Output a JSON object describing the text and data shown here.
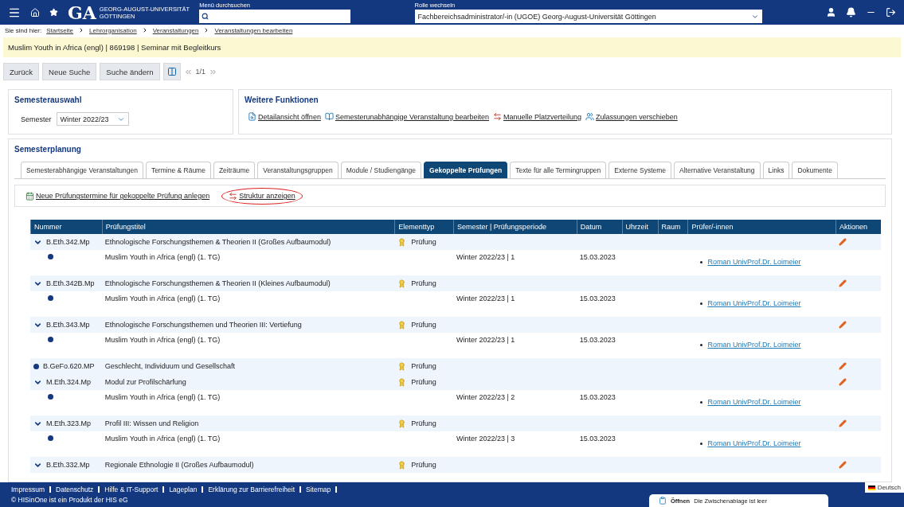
{
  "header": {
    "logo_mark": "GA",
    "logo_line_1": "GEORG-AUGUST-UNIVERSITÄT",
    "logo_line_2": "GÖTTINGEN",
    "search_label": "Menü durchsuchen",
    "role_label": "Rolle wechseln",
    "role_value": "Fachbereichsadministrator/-in (UGOE) Georg-August-Universität Göttingen"
  },
  "breadcrumb": {
    "label": "Sie sind hier:",
    "items": [
      "Startseite",
      "Lehrorganisation",
      "Veranstaltungen",
      "Veranstaltungen bearbeiten"
    ]
  },
  "title_bar": "Muslim Youth in Africa (engl) | 869198 | Seminar mit Begleitkurs",
  "toolbar": {
    "buttons": [
      "Zurück",
      "Neue Suche",
      "Suche ändern"
    ],
    "pager": "1/1"
  },
  "semester_panel": {
    "title": "Semesterauswahl",
    "label": "Semester",
    "value": "Winter 2022/23"
  },
  "functions_panel": {
    "title": "Weitere Funktionen",
    "links": [
      {
        "kind": "detail",
        "label": "Detailansicht öffnen"
      },
      {
        "kind": "book",
        "label": "Semesterunabhängige Veranstaltung bearbeiten"
      },
      {
        "kind": "swap",
        "label": "Manuelle Platzverteilung"
      },
      {
        "kind": "people",
        "label": "Zulassungen verschieben"
      }
    ]
  },
  "planning": {
    "title": "Semesterplanung",
    "tabs": [
      {
        "label": "Semesterabhängige Veranstaltungen",
        "selected": false
      },
      {
        "label": "Termine & Räume",
        "selected": false
      },
      {
        "label": "Zeiträume",
        "selected": false
      },
      {
        "label": "Veranstaltungsgruppen",
        "selected": false
      },
      {
        "label": "Module / Studiengänge",
        "selected": false
      },
      {
        "label": "Gekoppelte Prüfungen",
        "selected": true
      },
      {
        "label": "Texte für alle Termingruppen",
        "selected": false
      },
      {
        "label": "Externe Systeme",
        "selected": false
      },
      {
        "label": "Alternative Veranstaltung",
        "selected": false
      },
      {
        "label": "Links",
        "selected": false
      },
      {
        "label": "Dokumente",
        "selected": false
      }
    ],
    "actions": [
      {
        "kind": "calendar",
        "label": "Neue Prüfungstermine für gekoppelte Prüfung anlegen",
        "circled": false
      },
      {
        "kind": "swap",
        "label": "Struktur anzeigen",
        "circled": true
      }
    ]
  },
  "table": {
    "columns": [
      "Nummer",
      "Prüfungstitel",
      "Elementtyp",
      "Semester | Prüfungsperiode",
      "Datum",
      "Uhrzeit",
      "Raum",
      "Prüfer/-innen",
      "Aktionen"
    ],
    "rows": [
      {
        "kind": "branch",
        "expanded": true,
        "number": "B.Eth.342.Mp",
        "title": "Ethnologische Forschungsthemen & Theorien II (Großes Aufbaumodul)",
        "type": "Prüfung",
        "children": [
          {
            "title": "Muslim Youth in Africa (engl) (1. TG)",
            "semester": "Winter 2022/23 | 1",
            "date": "15.03.2023",
            "examiner": "Roman UnivProf.Dr. Loimeier"
          }
        ]
      },
      {
        "kind": "branch",
        "expanded": true,
        "number": "B.Eth.342B.Mp",
        "title": "Ethnologische Forschungsthemen & Theorien II (Kleines Aufbaumodul)",
        "type": "Prüfung",
        "children": [
          {
            "title": "Muslim Youth in Africa (engl) (1. TG)",
            "semester": "Winter 2022/23 | 1",
            "date": "15.03.2023",
            "examiner": "Roman UnivProf.Dr. Loimeier"
          }
        ]
      },
      {
        "kind": "branch",
        "expanded": true,
        "number": "B.Eth.343.Mp",
        "title": "Ethnologische Forschungsthemen und Theorien III: Vertiefung",
        "type": "Prüfung",
        "children": [
          {
            "title": "Muslim Youth in Africa (engl) (1. TG)",
            "semester": "Winter 2022/23 | 1",
            "date": "15.03.2023",
            "examiner": "Roman UnivProf.Dr. Loimeier"
          }
        ]
      },
      {
        "kind": "leaf",
        "number": "B.GeFo.620.MP",
        "title": "Geschlecht, Individuum und Gesellschaft",
        "type": "Prüfung"
      },
      {
        "kind": "branch",
        "expanded": true,
        "number": "M.Eth.324.Mp",
        "title": "Modul zur Profilschärfung",
        "type": "Prüfung",
        "children": [
          {
            "title": "Muslim Youth in Africa (engl) (1. TG)",
            "semester": "Winter 2022/23 | 2",
            "date": "15.03.2023",
            "examiner": "Roman UnivProf.Dr. Loimeier"
          }
        ]
      },
      {
        "kind": "branch",
        "expanded": true,
        "number": "M.Eth.323.Mp",
        "title": "Profil III: Wissen und Religion",
        "type": "Prüfung",
        "children": [
          {
            "title": "Muslim Youth in Africa (engl) (1. TG)",
            "semester": "Winter 2022/23 | 3",
            "date": "15.03.2023",
            "examiner": "Roman UnivProf.Dr. Loimeier"
          }
        ]
      },
      {
        "kind": "branch",
        "expanded": true,
        "number": "B.Eth.332.Mp",
        "title": "Regionale Ethnologie II (Großes Aufbaumodul)",
        "type": "Prüfung"
      }
    ]
  },
  "footer": {
    "links": [
      "Impressum",
      "Datenschutz",
      "Hilfe & IT-Support",
      "Lageplan",
      "Erklärung zur Barrierefreiheit",
      "Sitemap"
    ],
    "copyright": "© HISinOne ist ein Produkt der HIS eG",
    "language": "Deutsch"
  },
  "notification": {
    "action": "Öffnen",
    "message": "Die Zwischenablage ist leer"
  }
}
